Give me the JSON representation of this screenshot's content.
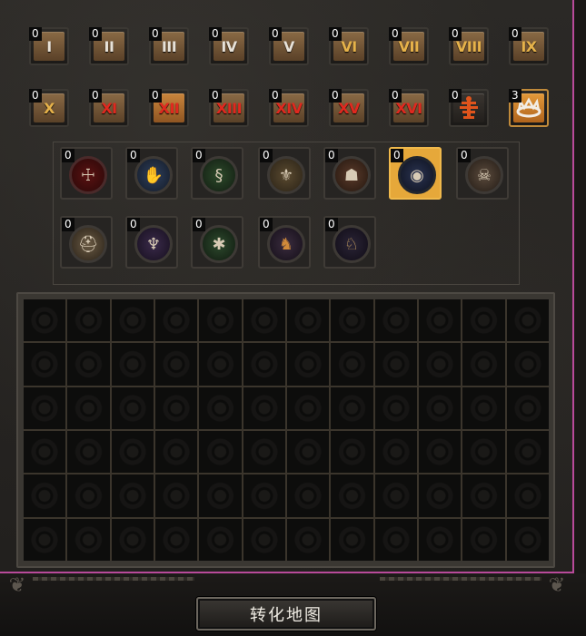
{
  "map_tabs": [
    {
      "label": "I",
      "count": "0",
      "style": "plain"
    },
    {
      "label": "II",
      "count": "0",
      "style": "plain"
    },
    {
      "label": "III",
      "count": "0",
      "style": "plain"
    },
    {
      "label": "IV",
      "count": "0",
      "style": "plain"
    },
    {
      "label": "V",
      "count": "0",
      "style": "plain"
    },
    {
      "label": "VI",
      "count": "0",
      "style": "gold"
    },
    {
      "label": "VII",
      "count": "0",
      "style": "gold"
    },
    {
      "label": "VIII",
      "count": "0",
      "style": "gold"
    },
    {
      "label": "IX",
      "count": "0",
      "style": "gold"
    },
    {
      "label": "X",
      "count": "0",
      "style": "gold"
    },
    {
      "label": "XI",
      "count": "0",
      "style": "red"
    },
    {
      "label": "XII",
      "count": "0",
      "style": "red-selected"
    },
    {
      "label": "XIII",
      "count": "0",
      "style": "red"
    },
    {
      "label": "XIV",
      "count": "0",
      "style": "red"
    },
    {
      "label": "XV",
      "count": "0",
      "style": "red"
    },
    {
      "label": "XVI",
      "count": "0",
      "style": "red"
    },
    {
      "label": "",
      "icon": "shaper-tree-icon",
      "count": "0",
      "style": "plain"
    },
    {
      "label": "",
      "icon": "crown-icon",
      "count": "3",
      "style": "selected"
    }
  ],
  "special_maps": [
    {
      "icon": "red-sigil-icon",
      "count": "0"
    },
    {
      "icon": "blue-hand-icon",
      "count": "0"
    },
    {
      "icon": "green-serpent-icon",
      "count": "0"
    },
    {
      "icon": "golden-wings-icon",
      "count": "0"
    },
    {
      "icon": "beast-face-icon",
      "count": "0"
    },
    {
      "icon": "dark-orb-icon",
      "count": "0",
      "selected": true
    },
    {
      "icon": "skull-icon",
      "count": "0"
    },
    {
      "icon": "helm-icon",
      "count": "0"
    },
    {
      "icon": "purple-dragon-icon",
      "count": "0"
    },
    {
      "icon": "green-crab-icon",
      "count": "0"
    },
    {
      "icon": "orange-hound-icon",
      "count": "0"
    },
    {
      "icon": "bronze-beast-icon",
      "count": "0"
    }
  ],
  "grid": {
    "columns": 12,
    "rows": 6
  },
  "convert_button": {
    "label": "转化地图"
  },
  "colors": {
    "accent": "#e6a83a",
    "border_pink": "#b84a9a",
    "red_tier": "#e0291f",
    "gold_tier": "#e6b24a"
  }
}
